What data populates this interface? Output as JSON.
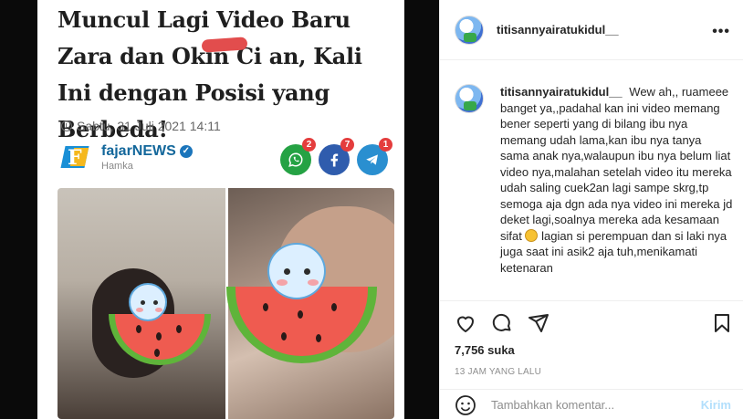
{
  "article": {
    "title": "Muncul Lagi Video Baru Zara dan Okin Ci     an, Kali Ini dengan Posisi yang Berbeda!",
    "date": "Sabtu, 31 Juli 2021 14:11",
    "brand": "fajarNEWS",
    "author": "Hamka",
    "shares": {
      "whatsapp": "2",
      "facebook": "7",
      "telegram": "1"
    }
  },
  "post": {
    "username": "titisannyairatukidul__",
    "comment_user": "titisannyairatukidul__",
    "comment_text_1": "Wew ah,, ruameee banget ya,,padahal kan ini video memang bener seperti yang di bilang ibu nya memang udah lama,kan ibu nya tanya sama anak nya,walaupun ibu nya belum liat video nya,malahan setelah video itu mereka udah saling cuek2an lagi sampe skrg,tp semoga aja dgn ada nya video ini mereka jd deket lagi,soalnya mereka ada kesamaan sifat",
    "comment_text_2": " lagian si perempuan dan si laki nya juga saat ini asik2 aja tuh,menikamati ketenaran",
    "likes": "7,756 suka",
    "time_ago": "13 JAM YANG LALU",
    "comment_placeholder": "Tambahkan komentar...",
    "post_button": "Kirim"
  },
  "icons": [
    "clock-icon",
    "verified-icon",
    "whatsapp-icon",
    "facebook-icon",
    "telegram-icon",
    "more-icon",
    "heart-icon",
    "comment-icon",
    "share-icon",
    "bookmark-icon",
    "emoji-icon"
  ],
  "colors": {
    "accent_blue": "#0095f6",
    "post_disabled": "#b2dffc",
    "whatsapp": "#25a244",
    "facebook": "#2f5cad",
    "telegram": "#2a8fd0"
  }
}
